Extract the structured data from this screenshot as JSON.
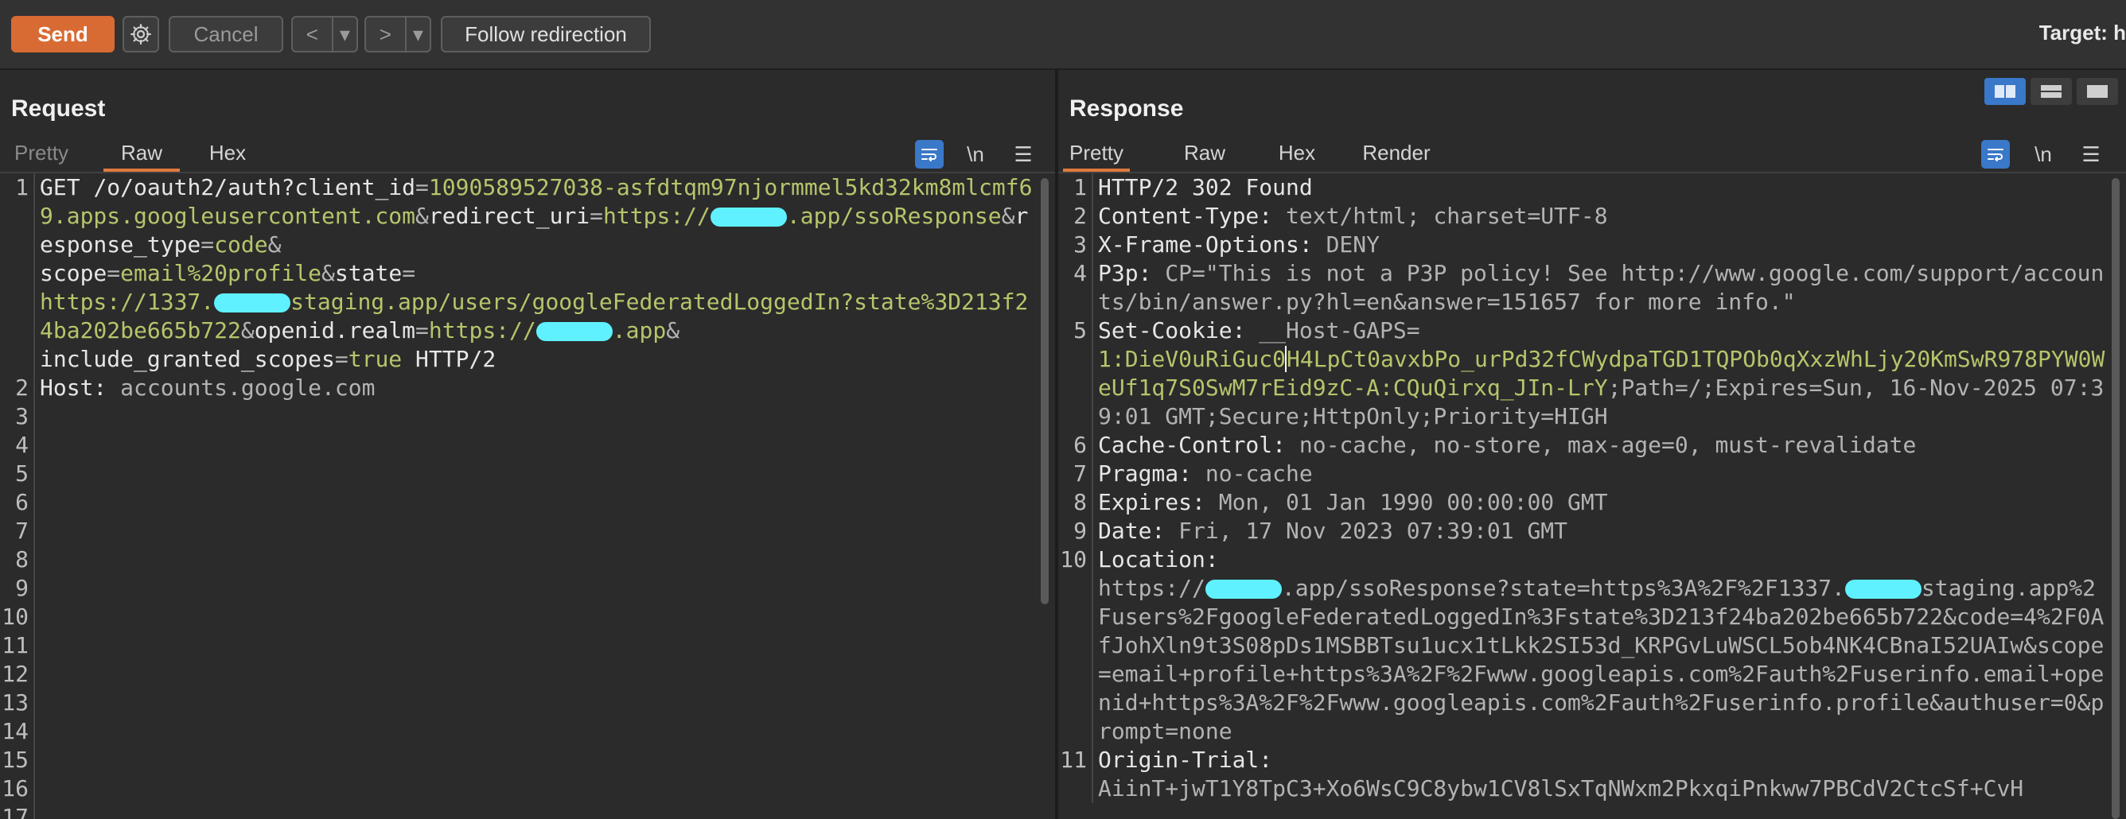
{
  "toolbar": {
    "send": "Send",
    "cancel": "Cancel",
    "back_arrow": "<",
    "fwd_arrow": ">",
    "dropdown": "▾",
    "follow": "Follow redirection",
    "target": "Target: h"
  },
  "request": {
    "title": "Request",
    "tabs": [
      "Pretty",
      "Raw",
      "Hex"
    ],
    "newline_toggle": "\\n",
    "menu": "☰"
  },
  "response": {
    "title": "Response",
    "tabs": [
      "Pretty",
      "Raw",
      "Hex",
      "Render"
    ],
    "newline_toggle": "\\n",
    "menu": "☰"
  },
  "request_lines": {
    "l1_method": "GET ",
    "l1_path": "/o/oauth2/auth?",
    "l1_p1": "client_id",
    "l1_v1": "1090589527038-asfdtqm97njormmel5kd32km8mlcmf69.apps.googleusercontent.com",
    "l1_p2": "redirect_uri",
    "l1_v2a": "https://",
    "l1_v2b": ".app/ssoResponse",
    "l1_p3": "response_type",
    "l1_v3": "code",
    "l1_p4": "scope",
    "l1_v4": "email%20profile",
    "l1_p5": "state",
    "l1_v5a": "https://1337.",
    "l1_v5b": "staging.app/users/googleFederatedLoggedIn?state%3D213f24ba202be665b722",
    "l1_p6": "openid.realm",
    "l1_v6a": "https://",
    "l1_v6b": ".app",
    "l1_p7": "include_granted_scopes",
    "l1_v7": "true",
    "l1_proto": " HTTP/2",
    "l2_key": "Host:",
    "l2_val": " accounts.google.com"
  },
  "response_lines": {
    "l1": "HTTP/2 302 Found",
    "l2k": "Content-Type:",
    "l2v": " text/html; charset=UTF-8",
    "l3k": "X-Frame-Options:",
    "l3v": " DENY",
    "l4k": "P3p:",
    "l4v": " CP=\"This is not a P3P policy! See http://www.google.com/support/accounts/bin/answer.py?hl=en&answer=151657 for more info.\"",
    "l5k": "Set-Cookie:",
    "l5n": " __Host-GAPS=",
    "l5va": "1:DieV0uRiGuc0",
    "l5vb": "H4LpCt0avxbPo_urPd32fCWydpaTGD1TQPOb0qXxzWhLjy20KmSwR978PYW0WeUf1q7S0SwM7rEid9zC-A:CQuQirxq_JIn-LrY",
    "l5rest": ";Path=/;Expires=Sun, 16-Nov-2025 07:39:01 GMT;Secure;HttpOnly;Priority=HIGH",
    "l6k": "Cache-Control:",
    "l6v": " no-cache, no-store, max-age=0, must-revalidate",
    "l7k": "Pragma:",
    "l7v": " no-cache",
    "l8k": "Expires:",
    "l8v": " Mon, 01 Jan 1990 00:00:00 GMT",
    "l9k": "Date:",
    "l9v": " Fri, 17 Nov 2023 07:39:01 GMT",
    "l10k": "Location:",
    "l10a": "https://",
    "l10b": ".app/ssoResponse?state=https%3A%2F%2F1337.",
    "l10c": "staging.app%2Fusers%2FgoogleFederatedLoggedIn%3Fstate%3D213f24ba202be665b722&code=4%2F0AfJohXln9t3S08pDs1MSBBTsu1ucx1tLkk2SI53d_KRPGvLuWSCL5ob4NK4CBnaI52UAIw&scope=email+profile+https%3A%2F%2Fwww.googleapis.com%2Fauth%2Fuserinfo.email+openid+https%3A%2F%2Fwww.googleapis.com%2Fauth%2Fuserinfo.profile&authuser=0&prompt=none",
    "l11k": "Origin-Trial:",
    "l11v": "AiinT+jwT1Y8TpC3+Xo6WsC9C8ybw1CV8lSxTqNWxm2PkxqiPnkww7PBCdV2CtcSf+CvH"
  }
}
